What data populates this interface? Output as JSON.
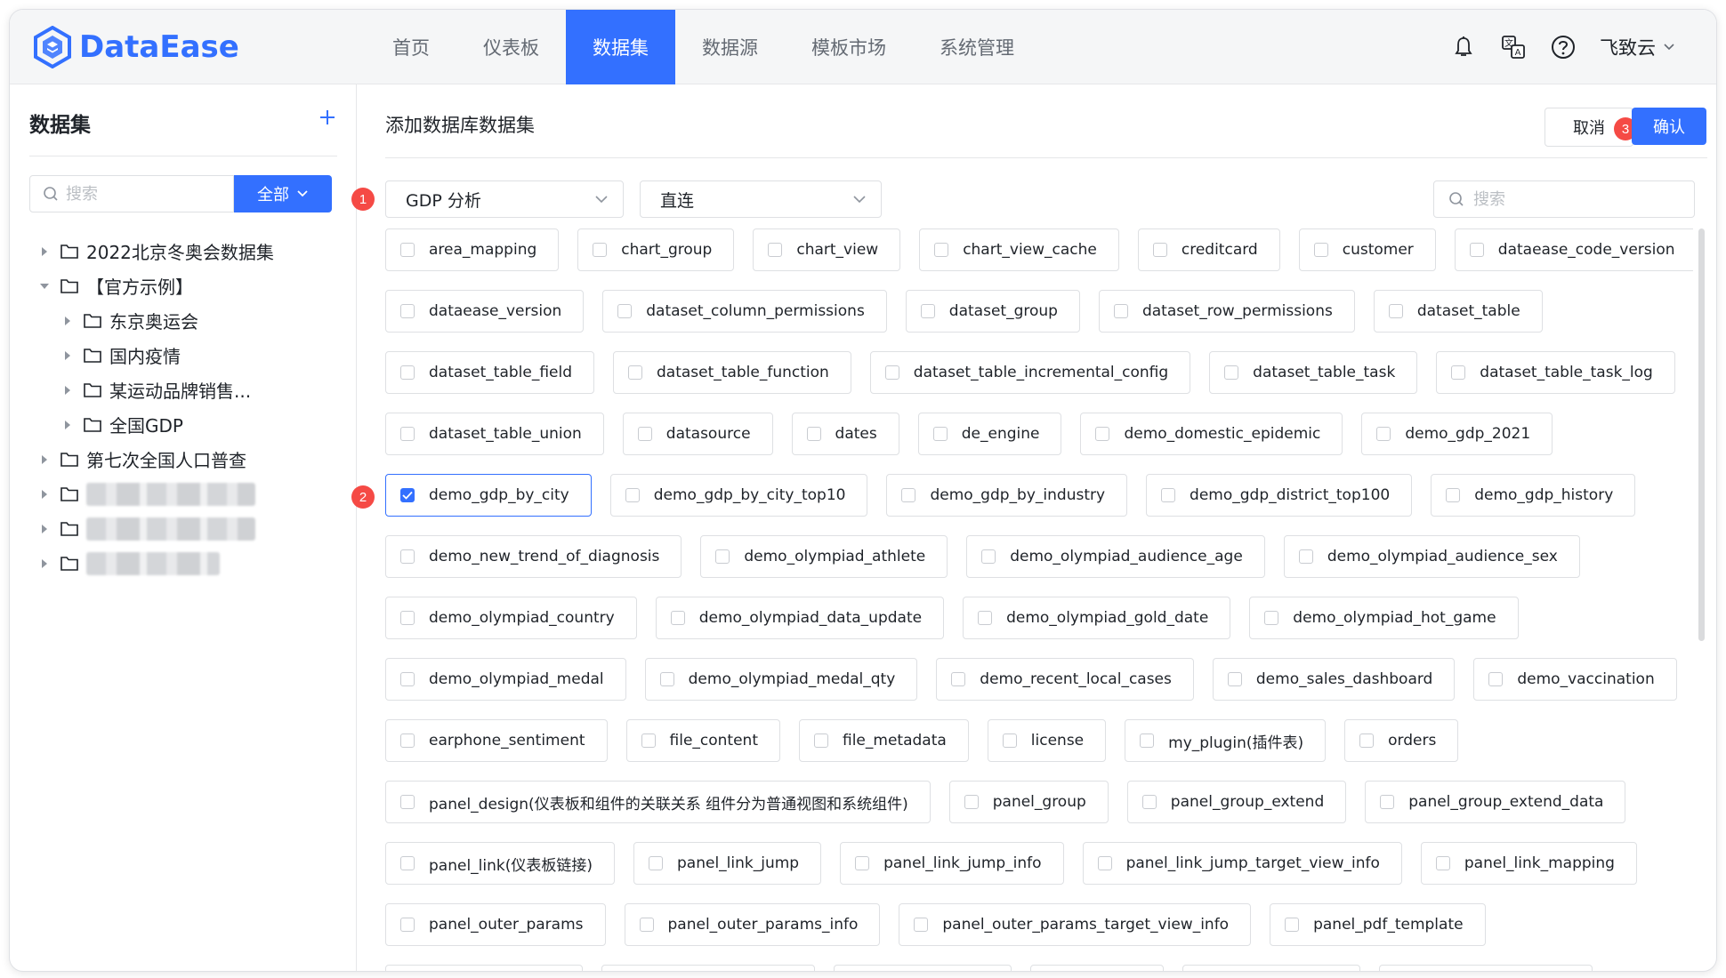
{
  "app": {
    "brand": "DataEase",
    "nav": [
      "首页",
      "仪表板",
      "数据集",
      "数据源",
      "模板市场",
      "系统管理"
    ],
    "nav_active_index": 2,
    "user_name": "飞致云",
    "colors": {
      "primary": "#3370ff",
      "step_badge": "#f54a45"
    }
  },
  "sidebar": {
    "title": "数据集",
    "search_placeholder": "搜索",
    "filter_label": "全部",
    "tree": [
      {
        "label": "2022北京冬奥会数据集",
        "level": 0,
        "expanded": false
      },
      {
        "label": "【官方示例】",
        "level": 0,
        "expanded": true
      },
      {
        "label": "东京奥运会",
        "level": 1,
        "expanded": false
      },
      {
        "label": "国内疫情",
        "level": 1,
        "expanded": false
      },
      {
        "label": "某运动品牌销售...",
        "level": 1,
        "expanded": false
      },
      {
        "label": "全国GDP",
        "level": 1,
        "expanded": false
      },
      {
        "label": "第七次全国人口普查",
        "level": 0,
        "expanded": false
      }
    ]
  },
  "main": {
    "title": "添加数据库数据集",
    "cancel_label": "取消",
    "ok_label": "确认",
    "steps": [
      "1",
      "2",
      "3"
    ],
    "datasource_value": "GDP 分析",
    "mode_value": "直连",
    "search_placeholder": "搜索",
    "table_rows": [
      [
        "area_mapping",
        "chart_group",
        "chart_view",
        "chart_view_cache",
        "creditcard",
        "customer",
        "dataease_code_version"
      ],
      [
        "dataease_version",
        "dataset_column_permissions",
        "dataset_group",
        "dataset_row_permissions",
        "dataset_table"
      ],
      [
        "dataset_table_field",
        "dataset_table_function",
        "dataset_table_incremental_config",
        "dataset_table_task",
        "dataset_table_task_log"
      ],
      [
        "dataset_table_union",
        "datasource",
        "dates",
        "de_engine",
        "demo_domestic_epidemic",
        "demo_gdp_2021"
      ],
      [
        "demo_gdp_by_city",
        "demo_gdp_by_city_top10",
        "demo_gdp_by_industry",
        "demo_gdp_district_top100",
        "demo_gdp_history"
      ],
      [
        "demo_new_trend_of_diagnosis",
        "demo_olympiad_athlete",
        "demo_olympiad_audience_age",
        "demo_olympiad_audience_sex"
      ],
      [
        "demo_olympiad_country",
        "demo_olympiad_data_update",
        "demo_olympiad_gold_date",
        "demo_olympiad_hot_game"
      ],
      [
        "demo_olympiad_medal",
        "demo_olympiad_medal_qty",
        "demo_recent_local_cases",
        "demo_sales_dashboard",
        "demo_vaccination"
      ],
      [
        "earphone_sentiment",
        "file_content",
        "file_metadata",
        "license",
        "my_plugin(插件表)",
        "orders"
      ],
      [
        "panel_design(仪表板和组件的关联关系 组件分为普通视图和系统组件)",
        "panel_group",
        "panel_group_extend",
        "panel_group_extend_data"
      ],
      [
        "panel_link(仪表板链接)",
        "panel_link_jump",
        "panel_link_jump_info",
        "panel_link_jump_target_view_info",
        "panel_link_mapping"
      ],
      [
        "panel_outer_params",
        "panel_outer_params_info",
        "panel_outer_params_target_view_info",
        "panel_pdf_template"
      ],
      [
        "",
        "",
        "",
        "",
        "",
        ""
      ]
    ],
    "checked_table": "demo_gdp_by_city"
  }
}
